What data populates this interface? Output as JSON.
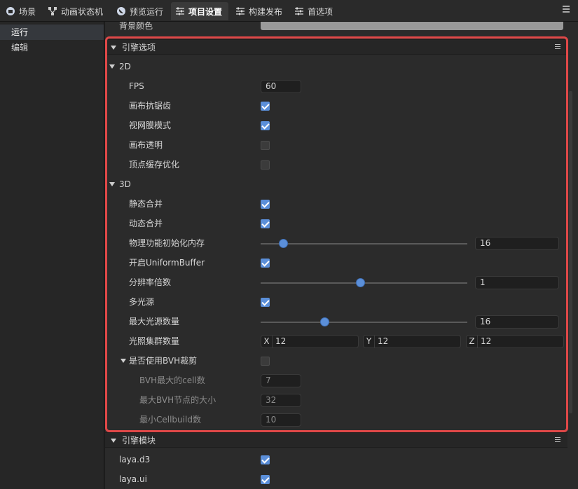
{
  "tabs": [
    {
      "label": "场景",
      "icon": "scene-icon"
    },
    {
      "label": "动画状态机",
      "icon": "state-machine-icon"
    },
    {
      "label": "预览运行",
      "icon": "preview-icon"
    },
    {
      "label": "项目设置",
      "icon": "settings-sliders-icon",
      "active": true
    },
    {
      "label": "构建发布",
      "icon": "build-sliders-icon"
    },
    {
      "label": "首选项",
      "icon": "preferences-sliders-icon"
    }
  ],
  "nav": [
    {
      "label": "运行",
      "active": true
    },
    {
      "label": "编辑"
    }
  ],
  "background_color_label": "背景颜色",
  "engine_options": {
    "title": "引擎选项",
    "group_2d": "2D",
    "fps_label": "FPS",
    "fps_value": "60",
    "canvas_antialias_label": "画布抗锯齿",
    "retina_label": "视网膜模式",
    "canvas_transparent_label": "画布透明",
    "vertex_cache_label": "顶点缓存优化",
    "group_3d": "3D",
    "static_batch_label": "静态合并",
    "dynamic_batch_label": "动态合并",
    "physics_memory_label": "物理功能初始化内存",
    "physics_memory_value": "16",
    "physics_memory_level": 0.11,
    "uniform_buffer_label": "开启UniformBuffer",
    "resolution_label": "分辨率倍数",
    "resolution_value": "1",
    "resolution_level": 0.48,
    "multi_light_label": "多光源",
    "max_lights_label": "最大光源数量",
    "max_lights_value": "16",
    "max_lights_level": 0.31,
    "light_cluster_label": "光照集群数量",
    "cluster_x_axis": "X",
    "cluster_x": "12",
    "cluster_y_axis": "Y",
    "cluster_y": "12",
    "cluster_z_axis": "Z",
    "cluster_z": "12",
    "bvh_label": "是否使用BVH裁剪",
    "bvh_max_cell_label": "BVH最大的cell数",
    "bvh_max_cell_value": "7",
    "bvh_max_node_label": "最大BVH节点的大小",
    "bvh_max_node_value": "32",
    "min_cellbuild_label": "最小Cellbuild数",
    "min_cellbuild_value": "10"
  },
  "engine_modules": {
    "title": "引擎模块",
    "module1": "laya.d3",
    "module2": "laya.ui"
  },
  "colors": {
    "accent": "#5b8fd9",
    "highlight_border": "#e04848"
  }
}
